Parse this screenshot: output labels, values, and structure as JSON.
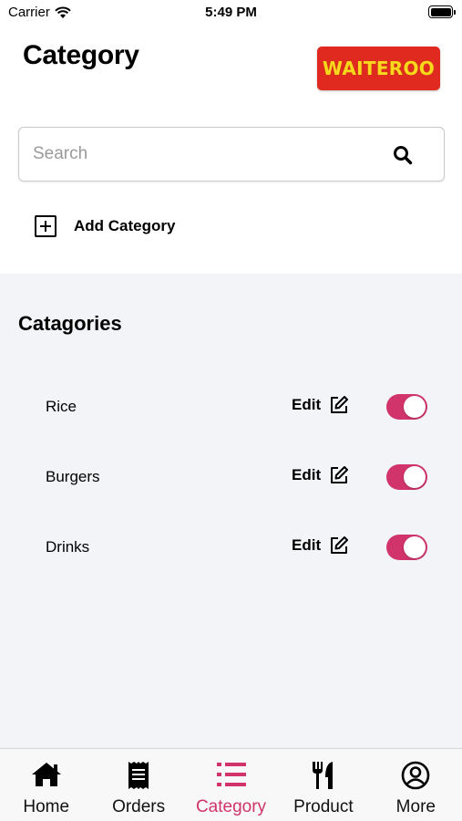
{
  "status_bar": {
    "carrier": "Carrier",
    "time": "5:49 PM"
  },
  "header": {
    "title": "Category",
    "logo_text": "WAITEROO"
  },
  "search": {
    "placeholder": "Search",
    "value": ""
  },
  "add_category": {
    "label": "Add Category"
  },
  "categories_section": {
    "title": "Catagories",
    "items": [
      {
        "name": "Rice",
        "edit_label": "Edit",
        "enabled": true
      },
      {
        "name": "Burgers",
        "edit_label": "Edit",
        "enabled": true
      },
      {
        "name": "Drinks",
        "edit_label": "Edit",
        "enabled": true
      }
    ]
  },
  "tab_bar": {
    "tabs": [
      {
        "label": "Home",
        "icon": "home-icon",
        "active": false
      },
      {
        "label": "Orders",
        "icon": "receipt-icon",
        "active": false
      },
      {
        "label": "Category",
        "icon": "list-icon",
        "active": true
      },
      {
        "label": "Product",
        "icon": "utensils-icon",
        "active": false
      },
      {
        "label": "More",
        "icon": "user-circle-icon",
        "active": false
      }
    ]
  },
  "colors": {
    "accent": "#d0346a",
    "logo_bg": "#e02a1f",
    "logo_text": "#f9d71c",
    "section_bg": "#f3f4f8"
  }
}
